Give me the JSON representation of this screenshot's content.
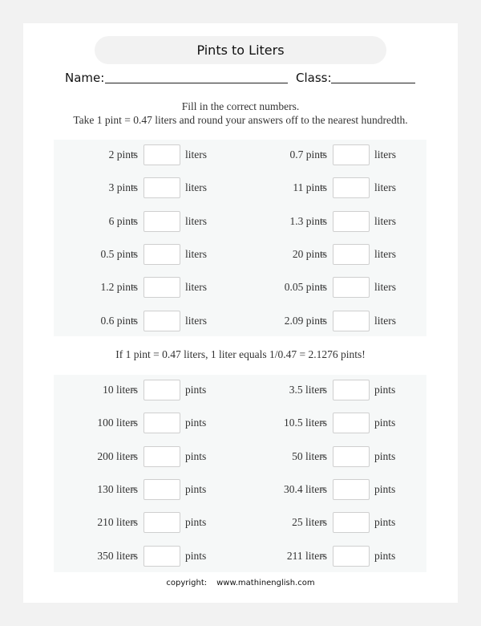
{
  "worksheet": {
    "title": "Pints to Liters",
    "name_label": "Name:",
    "class_label": "Class:",
    "instructions": [
      "Fill in the correct numbers.",
      "Take 1 pint = 0.47 liters and round your answers off to the nearest hundredth."
    ],
    "middle_note": "If 1 pint = 0.47 liters, 1 liter equals 1/0.47 = 2.1276 pints!",
    "equals_sign": "=",
    "section1": {
      "unit": "liters",
      "rows": [
        {
          "left": "2 pints",
          "right": "0.7 pints"
        },
        {
          "left": "3 pints",
          "right": "11 pints"
        },
        {
          "left": "6 pints",
          "right": "1.3 pints"
        },
        {
          "left": "0.5 pints",
          "right": "20 pints"
        },
        {
          "left": "1.2 pints",
          "right": "0.05 pints"
        },
        {
          "left": "0.6 pints",
          "right": "2.09 pints"
        }
      ]
    },
    "section2": {
      "unit": "pints",
      "rows": [
        {
          "left": "10 liters",
          "right": "3.5 liters"
        },
        {
          "left": "100 liters",
          "right": "10.5 liters"
        },
        {
          "left": "200 liters",
          "right": "50 liters"
        },
        {
          "left": "130 liters",
          "right": "30.4 liters"
        },
        {
          "left": "210 liters",
          "right": "25 liters"
        },
        {
          "left": "350 liters",
          "right": "211 liters"
        }
      ]
    },
    "answers_section1": [
      [
        "",
        ""
      ],
      [
        "",
        ""
      ],
      [
        "",
        ""
      ],
      [
        "",
        ""
      ],
      [
        "",
        ""
      ],
      [
        "",
        ""
      ]
    ],
    "answers_section2": [
      [
        "",
        ""
      ],
      [
        "",
        ""
      ],
      [
        "",
        ""
      ],
      [
        "",
        ""
      ],
      [
        "",
        ""
      ],
      [
        "",
        ""
      ]
    ],
    "copyright_label": "copyright:",
    "copyright_site": "www.mathinenglish.com"
  }
}
